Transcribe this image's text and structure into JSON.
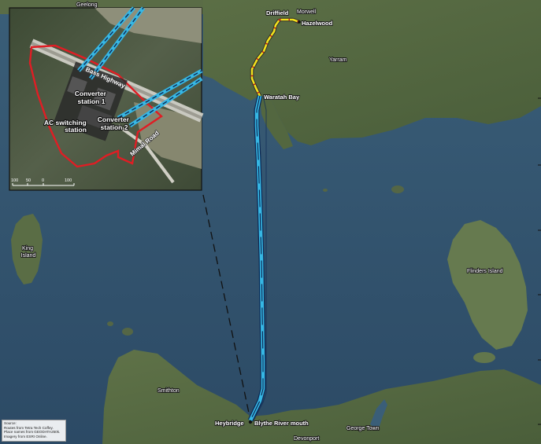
{
  "map": {
    "places": [
      {
        "key": "geelong",
        "label": "Geelong"
      },
      {
        "key": "driffield",
        "label": "Driffield"
      },
      {
        "key": "morwell",
        "label": "Morwell"
      },
      {
        "key": "hazelwood",
        "label": "Hazelwood"
      },
      {
        "key": "yarram",
        "label": "Yarram"
      },
      {
        "key": "waratah-bay",
        "label": "Waratah Bay"
      },
      {
        "key": "king-island",
        "label": "King Island"
      },
      {
        "key": "flinders-island",
        "label": "Flinders Island"
      },
      {
        "key": "smithton",
        "label": "Smithton"
      },
      {
        "key": "heybridge",
        "label": "Heybridge"
      },
      {
        "key": "blythe-river-mouth",
        "label": "Blythe River mouth"
      },
      {
        "key": "devonport",
        "label": "Devonport"
      },
      {
        "key": "george-town",
        "label": "George Town"
      }
    ],
    "colors": {
      "cable": "#36b7e4",
      "cable_dash": "#0d2a55",
      "land_route": "#f2e21c",
      "site_boundary": "#e01d24",
      "sea": "#2f4f6b"
    }
  },
  "inset": {
    "labels": {
      "converter1": [
        "Converter",
        "station 1"
      ],
      "converter2": [
        "Converter",
        "station 2"
      ],
      "ac_switching": [
        "AC switching",
        "station"
      ],
      "bass_highway": "Bass Highway",
      "mimal_road": "Mimal Road"
    },
    "scale_ticks": [
      "100",
      "50",
      "0",
      "100"
    ]
  },
  "source": {
    "lines": [
      "Source:",
      "Routes from Tetra Tech Coffey.",
      "Place names from GEODATA250k.",
      "Imagery from ESRI Online."
    ]
  }
}
